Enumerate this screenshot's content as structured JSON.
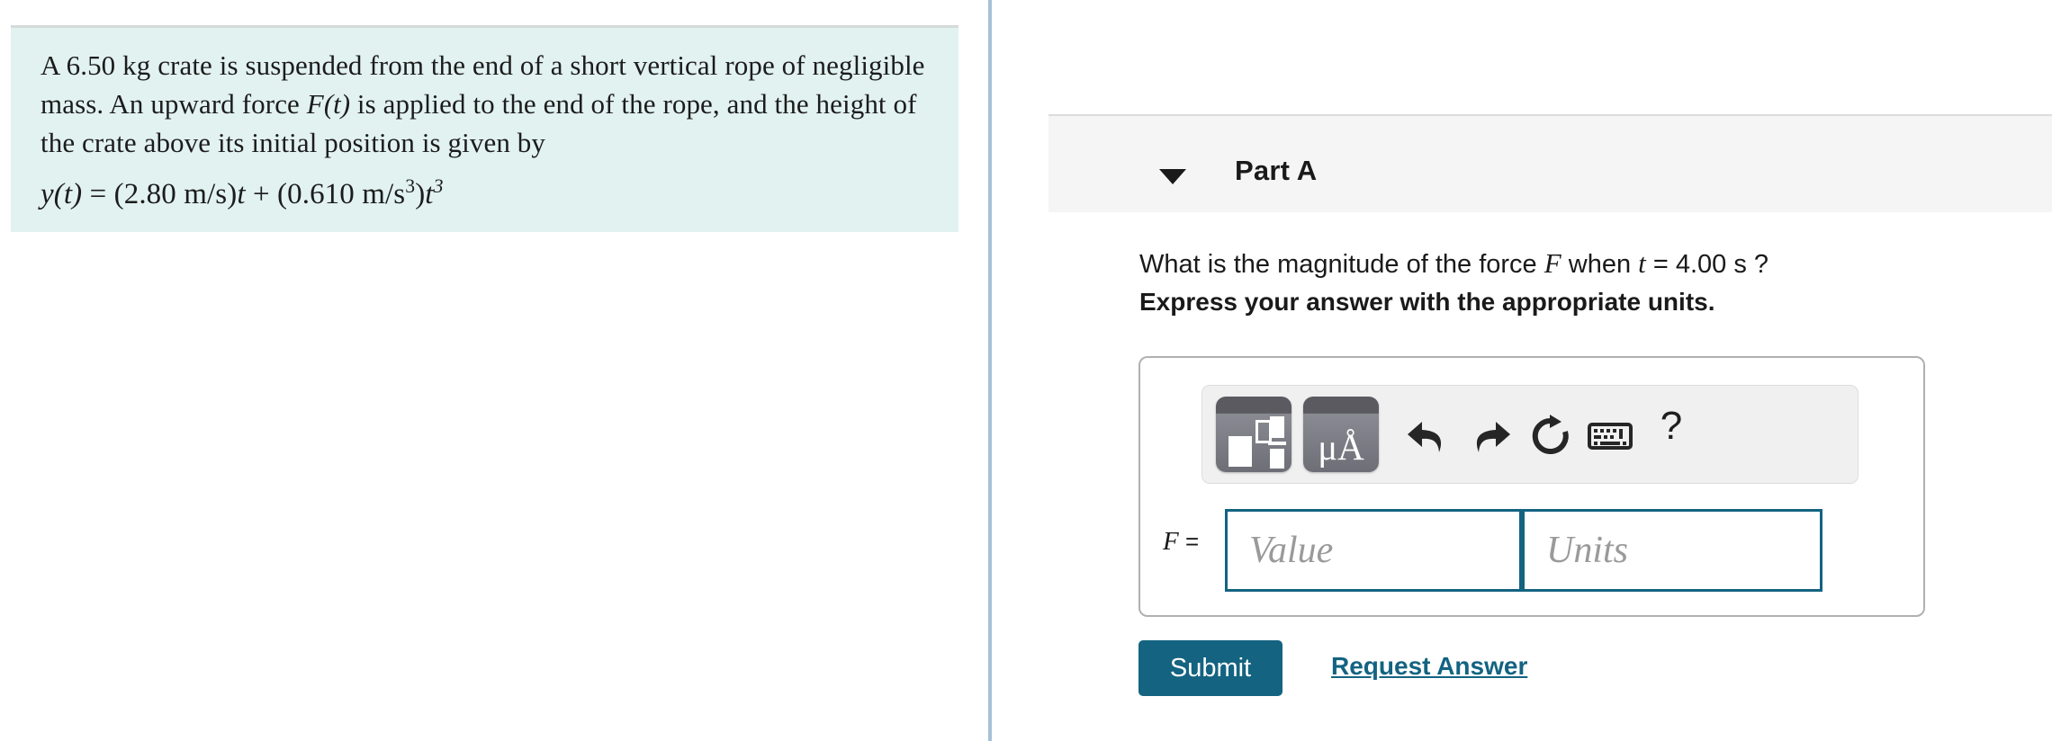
{
  "left": {
    "problem": {
      "text_part_1": "A 6.50 ",
      "unit_kg": "kg",
      "text_part_2": " crate is suspended from the end of a short vertical rope of negligible mass. An upward force ",
      "force_symbol": "F",
      "force_arg": "(t)",
      "text_part_3": " is applied to the end of the rope, and the height of the crate above its initial position is given by",
      "formula_plain": "y(t) = (2.80 m/s)t + (0.610 m/s³)t³",
      "formula": {
        "y": "y",
        "open_t": "(t)",
        "equals": "=",
        "term1_open": "(2.80 ",
        "term1_unit": "m/s",
        "term1_close": ")",
        "term1_var": "t",
        "plus": "+",
        "term2_open": "(0.610 ",
        "term2_unit_base": "m/s",
        "term2_unit_exp": "3",
        "term2_close": ")",
        "term2_var": "t",
        "term2_var_exp": "3"
      }
    }
  },
  "right": {
    "part": {
      "title": "Part A",
      "caret_icon": "chevron-down-icon",
      "expanded": true
    },
    "question": {
      "prefix": "What is the magnitude of the force ",
      "force_symbol": "F",
      "middle": " when ",
      "time_symbol": "t",
      "time_value": " = 4.00 s ?",
      "instruction": "Express your answer with the appropriate units."
    },
    "toolbar": {
      "items": [
        {
          "name": "math-template-button",
          "icon": "math-template-icon",
          "label": ""
        },
        {
          "name": "units-button",
          "icon": "micro-angstrom-icon",
          "label": "μÅ"
        },
        {
          "name": "undo-button",
          "icon": "undo-arrow-icon",
          "label": ""
        },
        {
          "name": "redo-button",
          "icon": "redo-arrow-icon",
          "label": ""
        },
        {
          "name": "reset-button",
          "icon": "reset-circular-arrow-icon",
          "label": ""
        },
        {
          "name": "keyboard-button",
          "icon": "keyboard-icon",
          "label": ""
        },
        {
          "name": "help-button",
          "icon": "question-mark-icon",
          "label": "?"
        }
      ],
      "units_glyph": "μÅ",
      "help_glyph": "?"
    },
    "answer": {
      "variable_label": "F",
      "equals": "=",
      "value_placeholder": "Value",
      "value_text": "",
      "units_placeholder": "Units",
      "units_text": ""
    },
    "actions": {
      "submit_label": "Submit",
      "request_answer_label": "Request Answer"
    }
  },
  "colors": {
    "problem_background": "#e1f2f0",
    "divider": "#a7c0d8",
    "part_header_background": "#f5f5f5",
    "accent": "#136381",
    "input_border": "#136381",
    "toolbar_background": "#f0f0f0",
    "tile_dark": "#5a5a60",
    "placeholder_text": "#9a9a9a"
  }
}
